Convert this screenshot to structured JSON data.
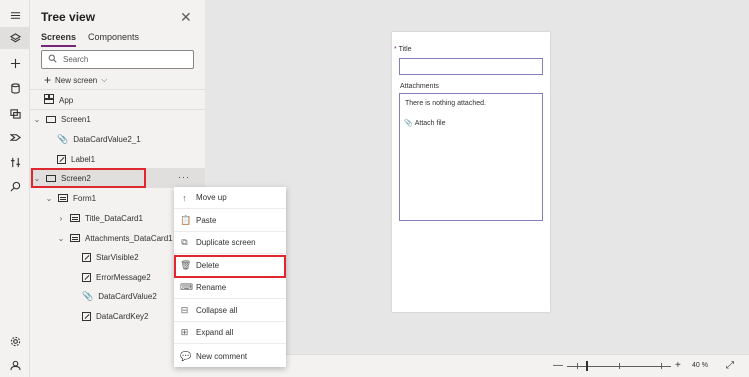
{
  "panel": {
    "title": "Tree view",
    "tabs": [
      "Screens",
      "Components"
    ],
    "search_placeholder": "Search",
    "new_screen": "New screen"
  },
  "tree": {
    "app": "App",
    "screen1": "Screen1",
    "datacard_value2_1": "DataCardValue2_1",
    "label1": "Label1",
    "screen2": "Screen2",
    "form1": "Form1",
    "title_datacard1": "Title_DataCard1",
    "attachments_datacard1": "Attachments_DataCard1",
    "starvisible2": "StarVisible2",
    "errormessage2": "ErrorMessage2",
    "datacardvalue2": "DataCardValue2",
    "datacardkey2": "DataCardKey2",
    "more": "···"
  },
  "menu": {
    "move_up": "Move up",
    "paste": "Paste",
    "duplicate": "Duplicate screen",
    "delete": "Delete",
    "rename": "Rename",
    "collapse": "Collapse all",
    "expand": "Expand all",
    "comment": "New comment"
  },
  "form": {
    "req": "*",
    "title_label": "Title",
    "attachments_label": "Attachments",
    "nothing": "There is nothing attached.",
    "attach_file": "Attach file"
  },
  "zoom": {
    "minus": "—",
    "plus": "+",
    "value": "40  %"
  },
  "colors": {
    "accent": "#742774",
    "highlight": "#e0262e"
  }
}
